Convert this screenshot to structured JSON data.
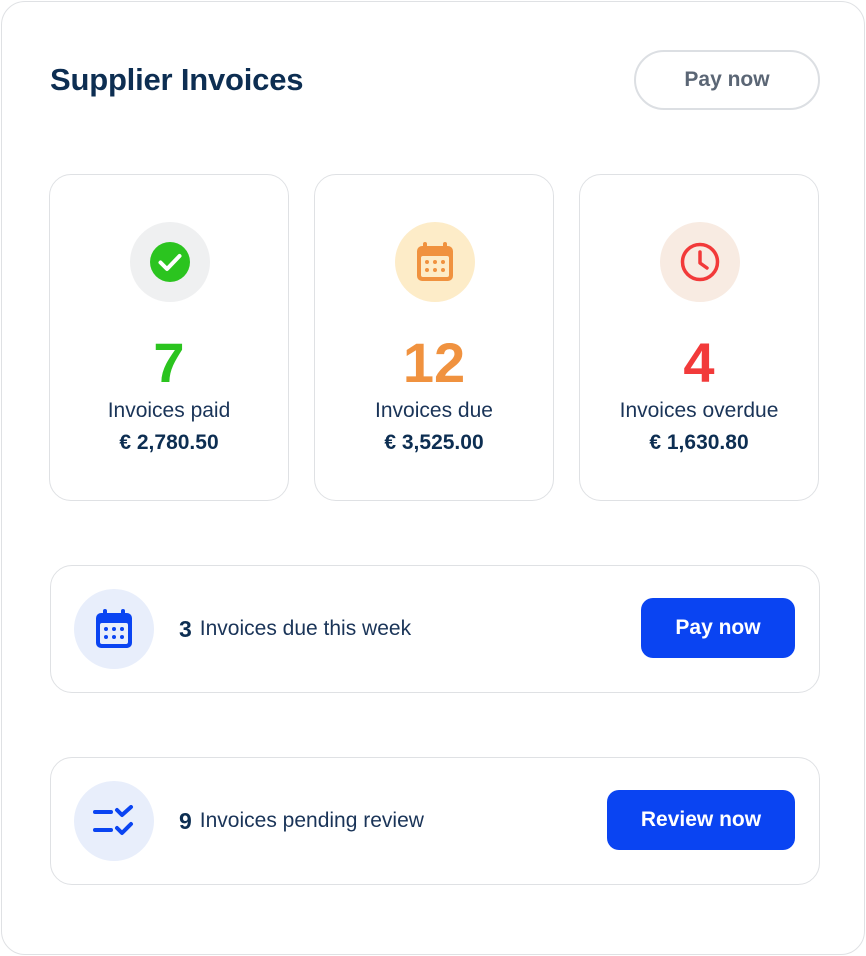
{
  "header": {
    "title": "Supplier Invoices",
    "pay_now_label": "Pay now"
  },
  "stats": [
    {
      "value": "7",
      "label": "Invoices paid",
      "amount": "€ 2,780.50",
      "icon": "check-circle-icon",
      "color": "#2bc41f",
      "badge_bg": "#eff0f1"
    },
    {
      "value": "12",
      "label": "Invoices due",
      "amount": "€ 3,525.00",
      "icon": "calendar-icon",
      "color": "#f0923f",
      "badge_bg": "#fdecc8"
    },
    {
      "value": "4",
      "label": "Invoices overdue",
      "amount": "€ 1,630.80",
      "icon": "clock-icon",
      "color": "#f23a3a",
      "badge_bg": "#f8ebe2"
    }
  ],
  "actions": [
    {
      "count": "3",
      "text": "Invoices due this week",
      "button": "Pay now",
      "icon": "calendar-icon"
    },
    {
      "count": "9",
      "text": "Invoices pending review",
      "button": "Review now",
      "icon": "checklist-icon"
    }
  ],
  "colors": {
    "accent": "#0a44f2",
    "title": "#0d2e52",
    "border": "#dfe1e4"
  }
}
